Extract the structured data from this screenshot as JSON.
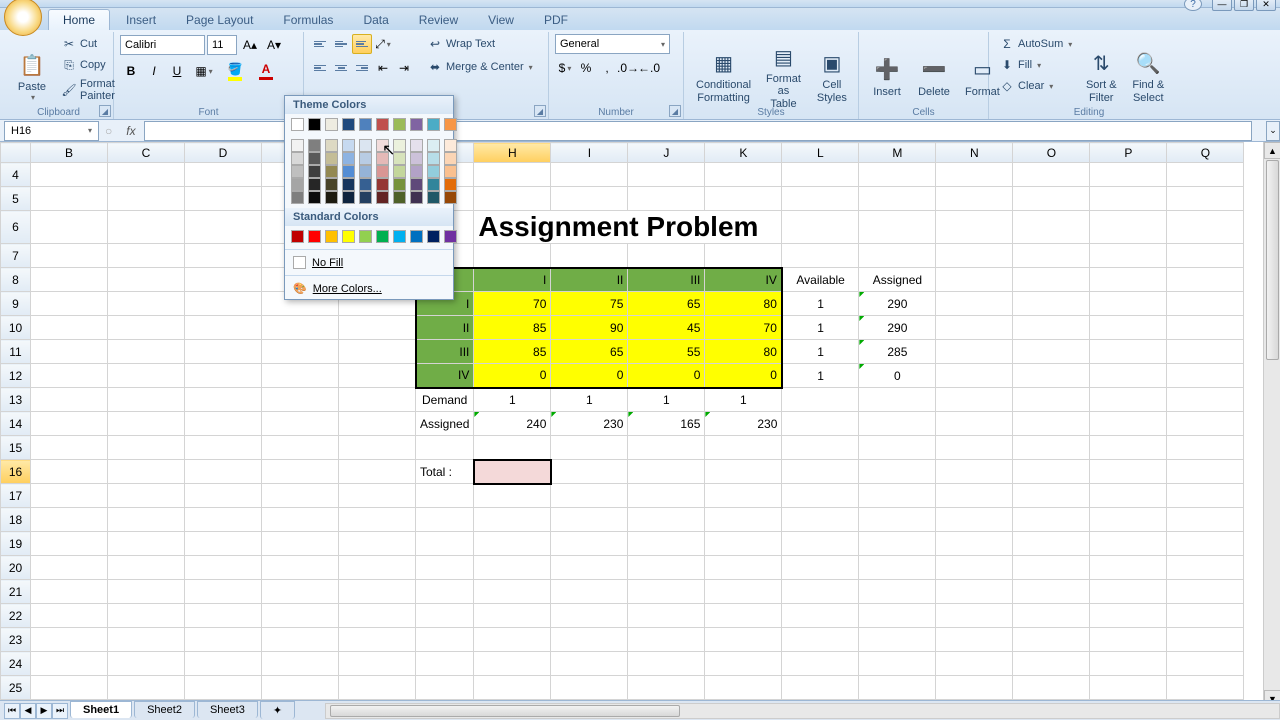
{
  "window": {
    "help": "?",
    "min": "—",
    "max": "❐",
    "close": "✕"
  },
  "tabs": [
    "Home",
    "Insert",
    "Page Layout",
    "Formulas",
    "Data",
    "Review",
    "View",
    "PDF"
  ],
  "activeTab": 0,
  "clipboard": {
    "paste": "Paste",
    "cut": "Cut",
    "copy": "Copy",
    "fmtPainter": "Format Painter",
    "label": "Clipboard"
  },
  "font": {
    "name": "Calibri",
    "size": "11",
    "label": "Font"
  },
  "alignment": {
    "wrap": "Wrap Text",
    "merge": "Merge & Center",
    "label": "Alignment"
  },
  "number": {
    "format": "General",
    "label": "Number"
  },
  "styles": {
    "cond": "Conditional\nFormatting",
    "fmtTable": "Format\nas Table",
    "cellStyles": "Cell\nStyles",
    "label": "Styles"
  },
  "cells": {
    "insert": "Insert",
    "delete": "Delete",
    "format": "Format",
    "label": "Cells"
  },
  "editing": {
    "autosum": "AutoSum",
    "fill": "Fill",
    "clear": "Clear",
    "sort": "Sort &\nFilter",
    "find": "Find &\nSelect",
    "label": "Editing"
  },
  "nameBox": "H16",
  "colorPopup": {
    "theme": "Theme Colors",
    "standard": "Standard Colors",
    "noFill": "No Fill",
    "more": "More Colors...",
    "themeRow1": [
      "#ffffff",
      "#000000",
      "#eeece1",
      "#1f497d",
      "#4f81bd",
      "#c0504d",
      "#9bbb59",
      "#8064a2",
      "#4bacc6",
      "#f79646"
    ],
    "themeShades": [
      [
        "#f2f2f2",
        "#7f7f7f",
        "#ddd9c3",
        "#c6d9f0",
        "#dbe5f1",
        "#f2dcdb",
        "#ebf1dd",
        "#e5e0ec",
        "#dbeef3",
        "#fdeada"
      ],
      [
        "#d8d8d8",
        "#595959",
        "#c4bd97",
        "#8db3e2",
        "#b8cce4",
        "#e5b9b7",
        "#d7e3bc",
        "#ccc1d9",
        "#b7dde8",
        "#fbd5b5"
      ],
      [
        "#bfbfbf",
        "#3f3f3f",
        "#938953",
        "#548dd4",
        "#95b3d7",
        "#d99694",
        "#c3d69b",
        "#b2a2c7",
        "#92cddc",
        "#fac08f"
      ],
      [
        "#a5a5a5",
        "#262626",
        "#494429",
        "#17365d",
        "#366092",
        "#953734",
        "#76923c",
        "#5f497a",
        "#31859b",
        "#e36c09"
      ],
      [
        "#7f7f7f",
        "#0c0c0c",
        "#1d1b10",
        "#0f243e",
        "#244061",
        "#632423",
        "#4f6128",
        "#3f3151",
        "#205867",
        "#974806"
      ]
    ],
    "standardRow": [
      "#c00000",
      "#ff0000",
      "#ffc000",
      "#ffff00",
      "#92d050",
      "#00b050",
      "#00b0f0",
      "#0070c0",
      "#002060",
      "#7030a0"
    ]
  },
  "columns": [
    "B",
    "C",
    "D",
    "E",
    "F",
    "G",
    "H",
    "I",
    "J",
    "K",
    "L",
    "M",
    "N",
    "O",
    "P",
    "Q"
  ],
  "rowStart": 4,
  "rowEnd": 26,
  "title": "Assignment Problem",
  "headers": {
    "col": [
      "I",
      "II",
      "III",
      "IV"
    ],
    "row": [
      "I",
      "II",
      "III",
      "IV"
    ],
    "avail": "Available",
    "assigned": "Assigned"
  },
  "matrix": [
    [
      70,
      75,
      65,
      80
    ],
    [
      85,
      90,
      45,
      70
    ],
    [
      85,
      65,
      55,
      80
    ],
    [
      0,
      0,
      0,
      0
    ]
  ],
  "available": [
    1,
    1,
    1,
    1
  ],
  "assignedRow": [
    290,
    290,
    285,
    0
  ],
  "demandLabel": "Demand",
  "demand": [
    1,
    1,
    1,
    1
  ],
  "assignedColLabel": "Assigned",
  "assignedCol": [
    240,
    230,
    165,
    230
  ],
  "totalLabel": "Total :",
  "sheets": [
    "Sheet1",
    "Sheet2",
    "Sheet3"
  ],
  "activeSheet": 0,
  "chart_data": {
    "type": "table",
    "title": "Assignment Problem",
    "row_labels": [
      "I",
      "II",
      "III",
      "IV"
    ],
    "col_labels": [
      "I",
      "II",
      "III",
      "IV"
    ],
    "values": [
      [
        70,
        75,
        65,
        80
      ],
      [
        85,
        90,
        45,
        70
      ],
      [
        85,
        65,
        55,
        80
      ],
      [
        0,
        0,
        0,
        0
      ]
    ],
    "available": [
      1,
      1,
      1,
      1
    ],
    "demand": [
      1,
      1,
      1,
      1
    ],
    "assigned_row_totals": [
      290,
      290,
      285,
      0
    ],
    "assigned_col_totals": [
      240,
      230,
      165,
      230
    ]
  }
}
